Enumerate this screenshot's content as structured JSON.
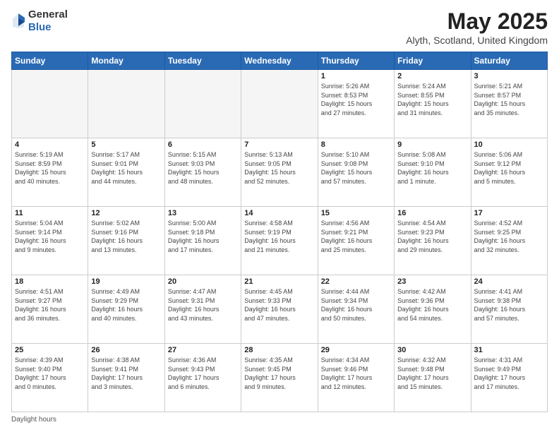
{
  "header": {
    "logo_general": "General",
    "logo_blue": "Blue",
    "title": "May 2025",
    "location": "Alyth, Scotland, United Kingdom"
  },
  "weekdays": [
    "Sunday",
    "Monday",
    "Tuesday",
    "Wednesday",
    "Thursday",
    "Friday",
    "Saturday"
  ],
  "footer": "Daylight hours",
  "weeks": [
    [
      {
        "day": "",
        "info": ""
      },
      {
        "day": "",
        "info": ""
      },
      {
        "day": "",
        "info": ""
      },
      {
        "day": "",
        "info": ""
      },
      {
        "day": "1",
        "info": "Sunrise: 5:26 AM\nSunset: 8:53 PM\nDaylight: 15 hours\nand 27 minutes."
      },
      {
        "day": "2",
        "info": "Sunrise: 5:24 AM\nSunset: 8:55 PM\nDaylight: 15 hours\nand 31 minutes."
      },
      {
        "day": "3",
        "info": "Sunrise: 5:21 AM\nSunset: 8:57 PM\nDaylight: 15 hours\nand 35 minutes."
      }
    ],
    [
      {
        "day": "4",
        "info": "Sunrise: 5:19 AM\nSunset: 8:59 PM\nDaylight: 15 hours\nand 40 minutes."
      },
      {
        "day": "5",
        "info": "Sunrise: 5:17 AM\nSunset: 9:01 PM\nDaylight: 15 hours\nand 44 minutes."
      },
      {
        "day": "6",
        "info": "Sunrise: 5:15 AM\nSunset: 9:03 PM\nDaylight: 15 hours\nand 48 minutes."
      },
      {
        "day": "7",
        "info": "Sunrise: 5:13 AM\nSunset: 9:05 PM\nDaylight: 15 hours\nand 52 minutes."
      },
      {
        "day": "8",
        "info": "Sunrise: 5:10 AM\nSunset: 9:08 PM\nDaylight: 15 hours\nand 57 minutes."
      },
      {
        "day": "9",
        "info": "Sunrise: 5:08 AM\nSunset: 9:10 PM\nDaylight: 16 hours\nand 1 minute."
      },
      {
        "day": "10",
        "info": "Sunrise: 5:06 AM\nSunset: 9:12 PM\nDaylight: 16 hours\nand 5 minutes."
      }
    ],
    [
      {
        "day": "11",
        "info": "Sunrise: 5:04 AM\nSunset: 9:14 PM\nDaylight: 16 hours\nand 9 minutes."
      },
      {
        "day": "12",
        "info": "Sunrise: 5:02 AM\nSunset: 9:16 PM\nDaylight: 16 hours\nand 13 minutes."
      },
      {
        "day": "13",
        "info": "Sunrise: 5:00 AM\nSunset: 9:18 PM\nDaylight: 16 hours\nand 17 minutes."
      },
      {
        "day": "14",
        "info": "Sunrise: 4:58 AM\nSunset: 9:19 PM\nDaylight: 16 hours\nand 21 minutes."
      },
      {
        "day": "15",
        "info": "Sunrise: 4:56 AM\nSunset: 9:21 PM\nDaylight: 16 hours\nand 25 minutes."
      },
      {
        "day": "16",
        "info": "Sunrise: 4:54 AM\nSunset: 9:23 PM\nDaylight: 16 hours\nand 29 minutes."
      },
      {
        "day": "17",
        "info": "Sunrise: 4:52 AM\nSunset: 9:25 PM\nDaylight: 16 hours\nand 32 minutes."
      }
    ],
    [
      {
        "day": "18",
        "info": "Sunrise: 4:51 AM\nSunset: 9:27 PM\nDaylight: 16 hours\nand 36 minutes."
      },
      {
        "day": "19",
        "info": "Sunrise: 4:49 AM\nSunset: 9:29 PM\nDaylight: 16 hours\nand 40 minutes."
      },
      {
        "day": "20",
        "info": "Sunrise: 4:47 AM\nSunset: 9:31 PM\nDaylight: 16 hours\nand 43 minutes."
      },
      {
        "day": "21",
        "info": "Sunrise: 4:45 AM\nSunset: 9:33 PM\nDaylight: 16 hours\nand 47 minutes."
      },
      {
        "day": "22",
        "info": "Sunrise: 4:44 AM\nSunset: 9:34 PM\nDaylight: 16 hours\nand 50 minutes."
      },
      {
        "day": "23",
        "info": "Sunrise: 4:42 AM\nSunset: 9:36 PM\nDaylight: 16 hours\nand 54 minutes."
      },
      {
        "day": "24",
        "info": "Sunrise: 4:41 AM\nSunset: 9:38 PM\nDaylight: 16 hours\nand 57 minutes."
      }
    ],
    [
      {
        "day": "25",
        "info": "Sunrise: 4:39 AM\nSunset: 9:40 PM\nDaylight: 17 hours\nand 0 minutes."
      },
      {
        "day": "26",
        "info": "Sunrise: 4:38 AM\nSunset: 9:41 PM\nDaylight: 17 hours\nand 3 minutes."
      },
      {
        "day": "27",
        "info": "Sunrise: 4:36 AM\nSunset: 9:43 PM\nDaylight: 17 hours\nand 6 minutes."
      },
      {
        "day": "28",
        "info": "Sunrise: 4:35 AM\nSunset: 9:45 PM\nDaylight: 17 hours\nand 9 minutes."
      },
      {
        "day": "29",
        "info": "Sunrise: 4:34 AM\nSunset: 9:46 PM\nDaylight: 17 hours\nand 12 minutes."
      },
      {
        "day": "30",
        "info": "Sunrise: 4:32 AM\nSunset: 9:48 PM\nDaylight: 17 hours\nand 15 minutes."
      },
      {
        "day": "31",
        "info": "Sunrise: 4:31 AM\nSunset: 9:49 PM\nDaylight: 17 hours\nand 17 minutes."
      }
    ]
  ]
}
